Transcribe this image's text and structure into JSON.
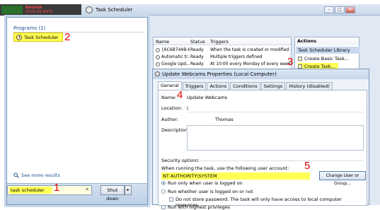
{
  "ticker": {
    "text1": "bourse",
    "text2": "10:00:49 WS75"
  },
  "window": {
    "title": "Task Scheduler",
    "minimize": "–",
    "maximize": "□",
    "close": "✕"
  },
  "start_menu": {
    "programs_heading": "Programs (1)",
    "result_item": "Task Scheduler",
    "see_more": "See more results",
    "search_value": "task scheduler",
    "search_clear": "✕",
    "shutdown_label": "Shut down",
    "shutdown_arrow": "▸"
  },
  "annotations": {
    "n1": "1",
    "n2": "2",
    "n3": "3",
    "n4": "4",
    "n5": "5"
  },
  "task_list": {
    "columns": [
      "Name",
      "Status",
      "Triggers"
    ],
    "rows": [
      {
        "name": "{6C6B744B-6...",
        "status": "Ready",
        "triggers": "When the task is created or modified"
      },
      {
        "name": "Automatic tr...",
        "status": "Ready",
        "triggers": "Multiple triggers defined"
      },
      {
        "name": "Google Upd...",
        "status": "Ready",
        "triggers": "At 10:00 every Monday of every week, star"
      }
    ]
  },
  "actions_panel": {
    "heading": "Actions",
    "library": "Task Scheduler Library",
    "items": [
      "Create Basic Task...",
      "Create Task..."
    ]
  },
  "dialog": {
    "title": "Update Webcams Properties (Local Computer)",
    "tabs": [
      "General",
      "Triggers",
      "Actions",
      "Conditions",
      "Settings",
      "History (disabled)"
    ],
    "name_label": "Name:",
    "name_value": "Update Webcams",
    "location_label": "Location:",
    "location_value": "\\",
    "author_label": "Author:",
    "author_value": "Thomas",
    "description_label": "Description:",
    "security_heading": "Security options",
    "account_prompt": "When running the task, use the following user account:",
    "account_value": "NT AUTHORITY\\SYSTEM",
    "change_button": "Change User or Group...",
    "radio_logged_on": "Run only when user is logged on",
    "radio_whether": "Run whether user is logged on or not",
    "checkbox_password": "Do not store password.  The task will only have access to local computer resources.",
    "checkbox_highest": "Run with highest privileges"
  }
}
